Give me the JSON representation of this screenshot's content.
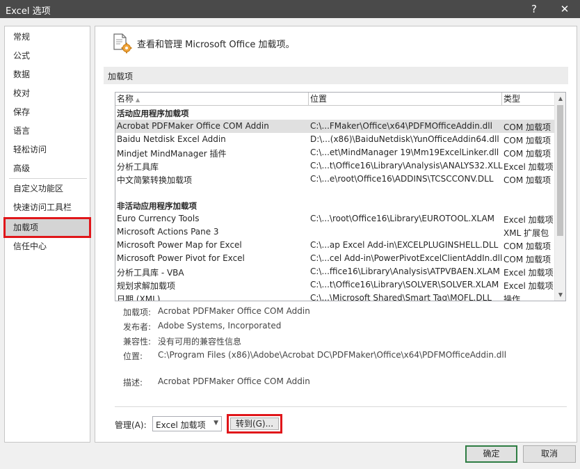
{
  "window": {
    "title": "Excel 选项",
    "help_glyph": "?",
    "close_glyph": "✕"
  },
  "sidebar": {
    "items": [
      {
        "label": "常规"
      },
      {
        "label": "公式"
      },
      {
        "label": "数据"
      },
      {
        "label": "校对"
      },
      {
        "label": "保存"
      },
      {
        "label": "语言"
      },
      {
        "label": "轻松访问"
      },
      {
        "label": "高级"
      },
      {
        "label": "自定义功能区"
      },
      {
        "label": "快速访问工具栏"
      },
      {
        "label": "加载项",
        "selected": true
      },
      {
        "label": "信任中心"
      }
    ]
  },
  "header": {
    "text": "查看和管理 Microsoft Office 加载项。",
    "icon": "addin-gear-icon"
  },
  "section": {
    "title": "加载项"
  },
  "table": {
    "columns": {
      "name": "名称",
      "location": "位置",
      "type": "类型"
    },
    "active_group": "活动应用程序加载项",
    "active": [
      {
        "name": "Acrobat PDFMaker Office COM Addin",
        "location": "C:\\...FMaker\\Office\\x64\\PDFMOfficeAddin.dll",
        "type": "COM 加载项"
      },
      {
        "name": "Baidu Netdisk Excel Addin",
        "location": "D:\\...(x86)\\BaiduNetdisk\\YunOfficeAddin64.dll",
        "type": "COM 加载项"
      },
      {
        "name": "Mindjet MindManager 插件",
        "location": "C:\\...et\\MindManager 19\\Mm19ExcelLinker.dll",
        "type": "COM 加载项"
      },
      {
        "name": "分析工具库",
        "location": "C:\\...t\\Office16\\Library\\Analysis\\ANALYS32.XLL",
        "type": "Excel 加载项"
      },
      {
        "name": "中文简繁转换加载项",
        "location": "C:\\...e\\root\\Office16\\ADDINS\\TCSCCONV.DLL",
        "type": "COM 加载项"
      }
    ],
    "inactive_group": "非活动应用程序加载项",
    "inactive": [
      {
        "name": "Euro Currency Tools",
        "location": "C:\\...\\root\\Office16\\Library\\EUROTOOL.XLAM",
        "type": "Excel 加载项"
      },
      {
        "name": "Microsoft Actions Pane 3",
        "location": "",
        "type": "XML 扩展包"
      },
      {
        "name": "Microsoft Power Map for Excel",
        "location": "C:\\...ap Excel Add-in\\EXCELPLUGINSHELL.DLL",
        "type": "COM 加载项"
      },
      {
        "name": "Microsoft Power Pivot for Excel",
        "location": "C:\\...cel Add-in\\PowerPivotExcelClientAddIn.dll",
        "type": "COM 加载项"
      },
      {
        "name": "分析工具库 - VBA",
        "location": "C:\\...ffice16\\Library\\Analysis\\ATPVBAEN.XLAM",
        "type": "Excel 加载项"
      },
      {
        "name": "规划求解加载项",
        "location": "C:\\...t\\Office16\\Library\\SOLVER\\SOLVER.XLAM",
        "type": "Excel 加载项"
      },
      {
        "name": "日期 (XML)",
        "location": "C:\\...\\Microsoft Shared\\Smart Tag\\MOFL.DLL",
        "type": "操作"
      }
    ]
  },
  "details": {
    "addin_label": "加载项:",
    "addin_value": "Acrobat PDFMaker Office COM Addin",
    "publisher_label": "发布者:",
    "publisher_value": "Adobe Systems, Incorporated",
    "compat_label": "兼容性:",
    "compat_value": "没有可用的兼容性信息",
    "location_label": "位置:",
    "location_value": "C:\\Program Files (x86)\\Adobe\\Acrobat DC\\PDFMaker\\Office\\x64\\PDFMOfficeAddin.dll",
    "desc_label": "描述:",
    "desc_value": "Acrobat PDFMaker Office COM Addin"
  },
  "manage": {
    "label": "管理(A):",
    "selected": "Excel 加载项",
    "goto_label": "转到(G)..."
  },
  "buttons": {
    "ok": "确定",
    "cancel": "取消"
  },
  "colors": {
    "titlebar": "#4a4a4a",
    "highlight_red": "#e0161a",
    "ok_border": "#2e7d43"
  }
}
